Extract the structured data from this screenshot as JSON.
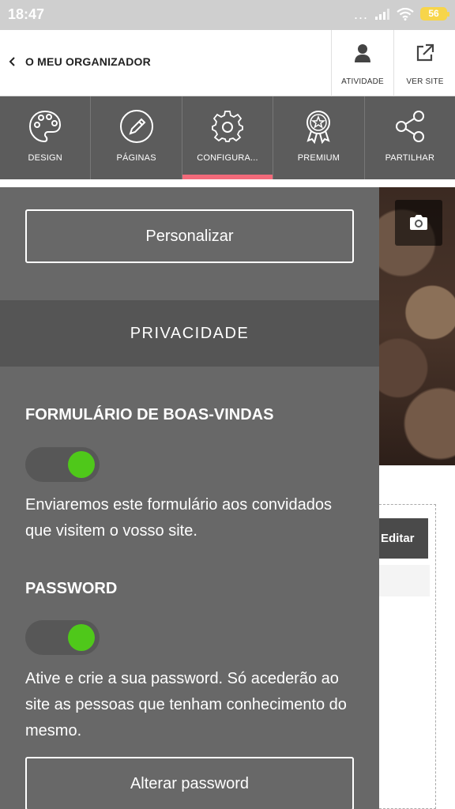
{
  "status_bar": {
    "time": "18:47",
    "signal_dots": "...",
    "battery": "56",
    "icons": [
      "signal-icon",
      "wifi-icon",
      "battery-icon"
    ]
  },
  "header": {
    "title": "O MEU ORGANIZADOR",
    "back_icon": "chevron-left-icon",
    "actions": [
      {
        "label": "ATIVIDADE",
        "icon": "user-icon"
      },
      {
        "label": "VER SITE",
        "icon": "external-link-icon"
      }
    ]
  },
  "tabs": [
    {
      "label": "DESIGN",
      "icon": "palette-icon"
    },
    {
      "label": "PÁGINAS",
      "icon": "pencil-icon"
    },
    {
      "label": "CONFIGURA...",
      "icon": "gear-icon",
      "active": true
    },
    {
      "label": "PREMIUM",
      "icon": "award-icon"
    },
    {
      "label": "PARTILHAR",
      "icon": "share-icon"
    }
  ],
  "panel": {
    "personalize_button": "Personalizar",
    "section_title": "PRIVACIDADE",
    "welcome_form": {
      "heading": "FORMULÁRIO DE BOAS-VINDAS",
      "toggle_on": true,
      "description": "Enviaremos este formulário aos convidados que visitem o vosso site."
    },
    "password": {
      "heading": "PASSWORD",
      "toggle_on": true,
      "description": "Ative e crie a sua password. Só acederão ao site as pessoas que tenham conhecimento do mesmo.",
      "change_button": "Alterar password"
    }
  },
  "background_page": {
    "edit_button": "Editar",
    "camera_icon": "camera-icon"
  },
  "colors": {
    "panel_bg": "#686868",
    "tab_bar_bg": "#5c5c5c",
    "active_tab_indicator": "#f26a7a",
    "toggle_knob": "#4fc81a",
    "battery": "#f7d54a"
  }
}
